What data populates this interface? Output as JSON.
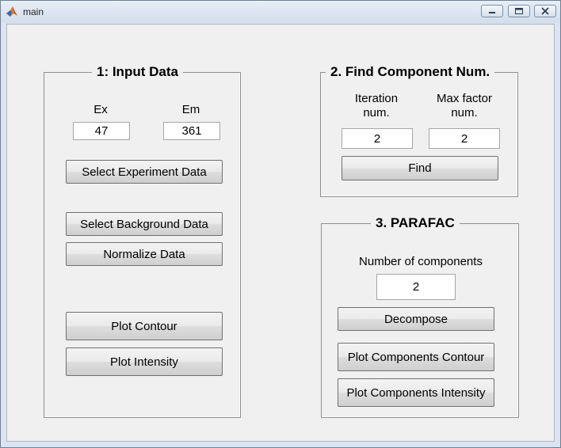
{
  "window": {
    "title": "main",
    "controls": {
      "minimize_icon": "minimize-icon",
      "maximize_icon": "maximize-icon",
      "close_icon": "close-icon"
    }
  },
  "input_panel": {
    "title": "1: Input Data",
    "ex_label": "Ex",
    "em_label": "Em",
    "ex_value": "47",
    "em_value": "361",
    "select_experiment_label": "Select Experiment Data",
    "select_background_label": "Select Background Data",
    "normalize_label": "Normalize Data",
    "plot_contour_label": "Plot Contour",
    "plot_intensity_label": "Plot Intensity"
  },
  "find_panel": {
    "title": "2. Find Component Num.",
    "iteration_label_line1": "Iteration",
    "iteration_label_line2": "num.",
    "max_factor_label_line1": "Max factor",
    "max_factor_label_line2": "num.",
    "iteration_value": "2",
    "max_factor_value": "2",
    "find_label": "Find"
  },
  "parafac_panel": {
    "title": "3. PARAFAC",
    "components_label": "Number of components",
    "components_value": "2",
    "decompose_label": "Decompose",
    "plot_components_contour_label": "Plot Components Contour",
    "plot_components_intensity_label": "Plot Components Intensity"
  }
}
